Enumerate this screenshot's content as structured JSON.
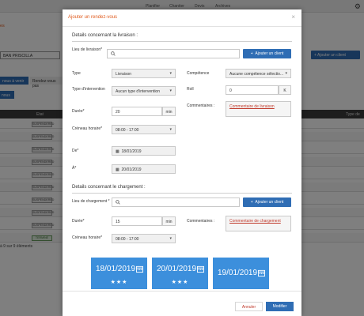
{
  "background": {
    "nav": [
      "Planifier",
      "Chantier",
      "Devis",
      "Archives"
    ],
    "page_title_partial": "es",
    "client_value": "BAN PRISCILLA",
    "add_client_label": "Ajouter un client",
    "tabs": [
      "nous à venir",
      "Rendez-vous pas"
    ],
    "small_button": "nous",
    "table_headers": [
      "Etat",
      "Type de"
    ],
    "row_badges": [
      "SUSPENDERED",
      "SUSPENDERED",
      "SUSPENDERED",
      "SUSPENDERED",
      "SUSPENDERED",
      "SUSPENDERED",
      "SUSPENDERED",
      "SUSPENDERED",
      "SUSPENDERED",
      "TERMINE"
    ],
    "footer_text": "à 9 sur 9 éléments"
  },
  "modal": {
    "title": "Ajouter un rendez-vous",
    "close": "×",
    "livraison": {
      "section_title": "Details concernant la livraison :",
      "lieu_label": "Lieu de livraison*",
      "lieu_value": "",
      "add_client_label": "Ajouter un client",
      "type_label": "Type",
      "type_value": "Livraison",
      "competence_label": "Compétence",
      "competence_value": "Aucune compétence sélectio...",
      "type_intervention_label": "Type d'intervention",
      "type_intervention_value": "Aucun type d'intervention",
      "roll_label": "Roll",
      "roll_value": "0",
      "roll_addon": "K",
      "duree_label": "Durée*",
      "duree_value": "20",
      "duree_unit": "min",
      "commentaires_label": "Commentaires :",
      "commentaires_value": "Commentaire de livraison",
      "creneau_label": "Créneau horaire*",
      "creneau_value": "08:00 - 17:00",
      "de_label": "De*",
      "de_value": "18/01/2019",
      "a_label": "À*",
      "a_value": "20/01/2019"
    },
    "chargement": {
      "section_title": "Details concernant le chargement :",
      "lieu_label": "Lieu de chargement *",
      "lieu_value": "",
      "add_client_label": "Ajouter un client",
      "duree_label": "Durée*",
      "duree_value": "15",
      "duree_unit": "min",
      "commentaires_label": "Commentaires :",
      "commentaires_value": "Commentaire de chargement",
      "creneau_label": "Créneau horaire*",
      "creneau_value": "08:00 - 17:00"
    },
    "date_cards": [
      {
        "date": "18/01/2019",
        "stars": "★★★"
      },
      {
        "date": "20/01/2019",
        "stars": "★★★"
      },
      {
        "date": "19/01/2019",
        "stars": ""
      }
    ],
    "footer": {
      "cancel_label": "Annuler",
      "submit_label": "Modifier"
    }
  }
}
